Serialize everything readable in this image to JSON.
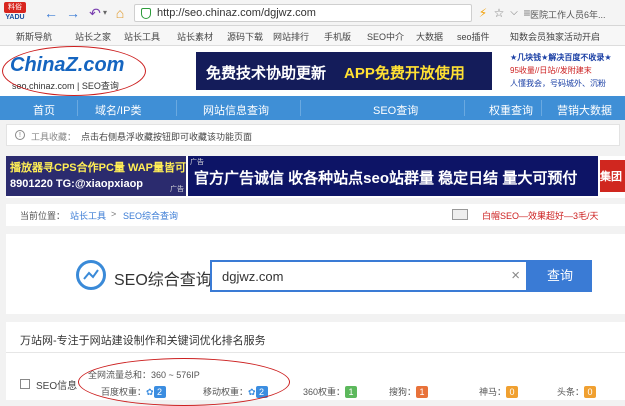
{
  "browser": {
    "logo_text": "YADU",
    "logo_badge": "料俗",
    "url": "http://seo.chinaz.com/dgjwz.com",
    "status_text": "医院工作人员6年..."
  },
  "bookmarks": [
    "新斯导航",
    "站长之家",
    "站长工具",
    "站长素材",
    "源码下载",
    "网站排行",
    "手机版",
    "SEO中介",
    "大数据",
    "seo插件",
    "知数会员独家活动开启"
  ],
  "header": {
    "logo_main": "ChinaZ.com",
    "logo_sub": "seo.chinaz.com | SEO查询",
    "ad_text_a": "免费技术协助更新",
    "ad_text_b": "APP免费开放使用",
    "promo_line1": "★几块钱★解决百度不收录★",
    "promo_line2": "95收量//日站//发附建末",
    "promo_line3": "人懂我会，号码城外、沉粉"
  },
  "nav": [
    "首页",
    "域名/IP类",
    "网站信息查询",
    "SEO查询",
    "权重查询",
    "营销大数据"
  ],
  "notice": {
    "label": "工具收藏：",
    "text": "点击右侧悬浮收藏按钮即可收藏该功能页面"
  },
  "banner": {
    "left_line1": "播放器寻CPS合作PC量 WAP量皆可",
    "left_line2": "8901220 TG:@xiaopxiaop",
    "left_tag": "广告",
    "right_tag": "广告",
    "main_text": "官方广告诚信 收各种站点seo站群量 稳定日结 量大可预付",
    "end_text": "集团"
  },
  "breadcrumb": {
    "prefix": "当前位置：",
    "items": [
      "站长工具",
      "SEO综合查询"
    ],
    "separator": ">",
    "promo": "白帽SEO—效果超好—3毛/天"
  },
  "search": {
    "title": "SEO综合查询",
    "value": "dgjwz.com",
    "clear": "×",
    "button": "查询"
  },
  "result": {
    "site_desc": "万站网-专注于网站建设制作和关键词优化排名服务",
    "section_label": "SEO信息",
    "traffic_label": "全网流量总和：",
    "traffic_value": "360 ~ 576IP",
    "weights": [
      {
        "label": "百度权重：",
        "value": "2",
        "color": "#3b8de0"
      },
      {
        "label": "移动权重：",
        "value": "2",
        "color": "#3b8de0"
      },
      {
        "label": "360权重：",
        "value": "1",
        "color": "#5cb85c"
      },
      {
        "label": "搜狗：",
        "value": "1",
        "color": "#e8723a"
      },
      {
        "label": "神马：",
        "value": "0",
        "color": "#f0a030"
      },
      {
        "label": "头条：",
        "value": "0",
        "color": "#f0a030"
      }
    ]
  },
  "colors": {
    "nav": "#3f8fd6",
    "accent": "#3a7bd5",
    "annotation": "#cc1f1f"
  }
}
